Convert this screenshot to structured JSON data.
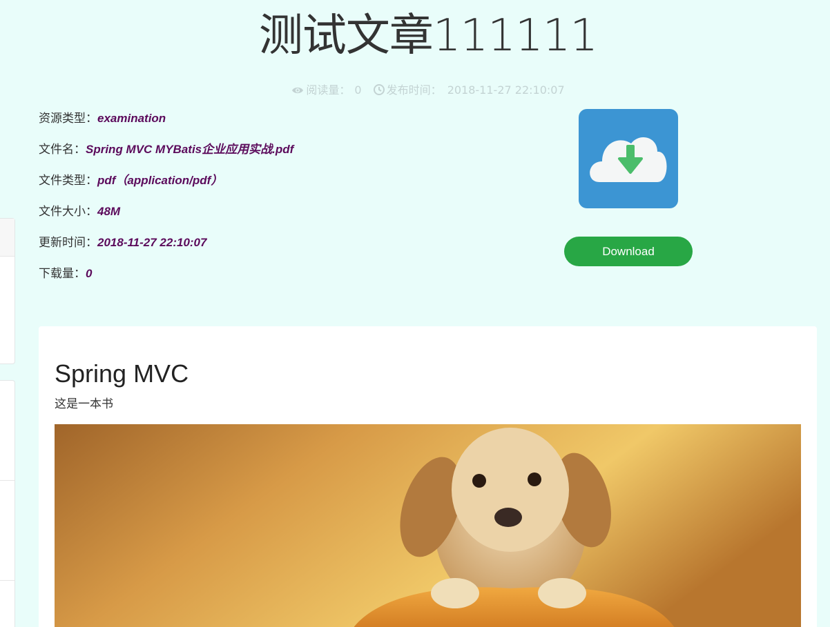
{
  "article": {
    "title": "测试文章111111",
    "read_label": "阅读量：",
    "read_count": "0",
    "publish_label": "发布时间：",
    "publish_time": "2018-11-27 22:10:07"
  },
  "resource": {
    "type_label": "资源类型：",
    "type_value": "examination",
    "filename_label": "文件名：",
    "filename_value": "Spring MVC MYBatis企业应用实战.pdf",
    "filetype_label": "文件类型：",
    "filetype_value": "pdf（application/pdf）",
    "size_label": "文件大小：",
    "size_value": "48M",
    "updated_label": "更新时间：",
    "updated_value": "2018-11-27 22:10:07",
    "downloads_label": "下载量：",
    "downloads_value": "0"
  },
  "download": {
    "icon": "cloud-download-icon",
    "button_label": "Download",
    "box_color": "#3c95d3",
    "button_color": "#28a745"
  },
  "content": {
    "heading": "Spring MVC",
    "description": "这是一本书",
    "image": "golden-retriever-puppy-in-pumpkin"
  }
}
